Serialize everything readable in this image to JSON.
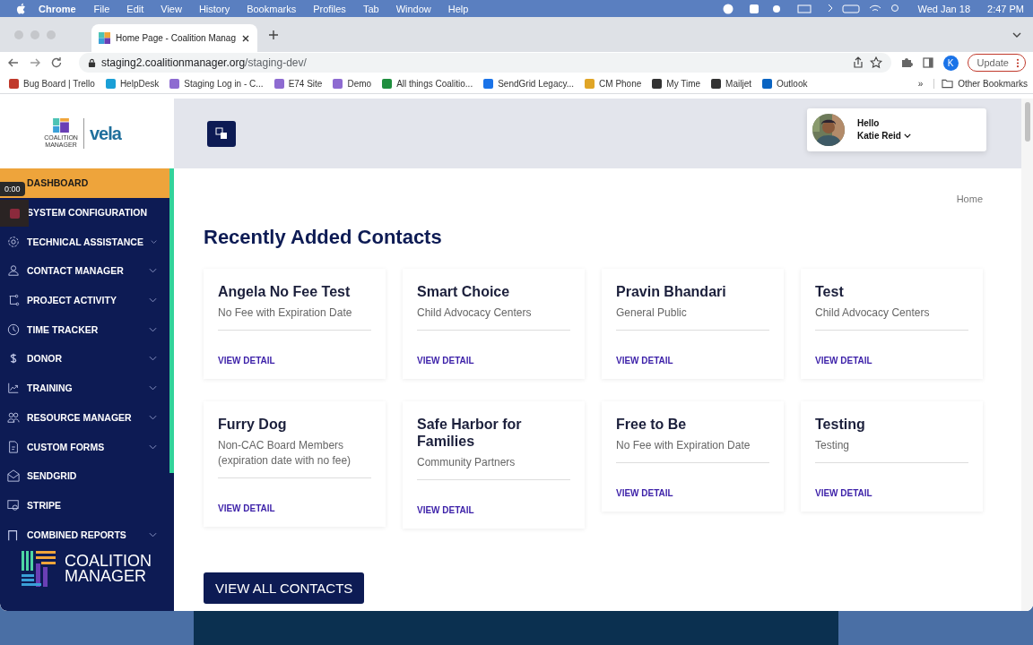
{
  "menubar": {
    "app": "Chrome",
    "menus": [
      "File",
      "Edit",
      "View",
      "History",
      "Bookmarks",
      "Profiles",
      "Tab",
      "Window",
      "Help"
    ],
    "date": "Wed Jan 18",
    "time": "2:47 PM"
  },
  "browser": {
    "tab_title": "Home Page - Coalition Manag",
    "url_host": "staging2.coalitionmanager.org",
    "url_path": "/staging-dev/",
    "profile": "K",
    "update_button": "Update",
    "bookmarks": [
      "Bug Board | Trello",
      "HelpDesk",
      "Staging Log in - C...",
      "E74 Site",
      "Demo",
      "All things Coalitio...",
      "SendGrid Legacy...",
      "CM Phone",
      "My Time",
      "Mailjet",
      "Outlook"
    ],
    "more": "»",
    "other_bookmarks": "Other Bookmarks"
  },
  "recording": {
    "time": "0:00"
  },
  "sidebar": {
    "logo": {
      "lines": [
        "COALITION",
        "MANAGER"
      ],
      "brand": "vela"
    },
    "items": [
      {
        "label": "DASHBOARD",
        "selected": true,
        "expandable": false
      },
      {
        "label": "SYSTEM CONFIGURATION",
        "selected": false,
        "expandable": false
      },
      {
        "label": "TECHNICAL ASSISTANCE",
        "selected": false,
        "expandable": true
      },
      {
        "label": "CONTACT MANAGER",
        "selected": false,
        "expandable": true
      },
      {
        "label": "PROJECT ACTIVITY",
        "selected": false,
        "expandable": true
      },
      {
        "label": "TIME TRACKER",
        "selected": false,
        "expandable": true
      },
      {
        "label": "DONOR",
        "selected": false,
        "expandable": true
      },
      {
        "label": "TRAINING",
        "selected": false,
        "expandable": true
      },
      {
        "label": "RESOURCE MANAGER",
        "selected": false,
        "expandable": true
      },
      {
        "label": "CUSTOM FORMS",
        "selected": false,
        "expandable": true
      },
      {
        "label": "SENDGRID",
        "selected": false,
        "expandable": false
      },
      {
        "label": "STRIPE",
        "selected": false,
        "expandable": false
      },
      {
        "label": "COMBINED REPORTS",
        "selected": false,
        "expandable": true
      }
    ],
    "footer_logo": [
      "COALITION",
      "MANAGER"
    ]
  },
  "header": {
    "greeting": "Hello",
    "user": "Katie Reid"
  },
  "breadcrumb": "Home",
  "title": "Recently Added Contacts",
  "contacts": [
    {
      "name": "Angela No Fee Test",
      "category": "No Fee with Expiration Date",
      "action": "VIEW DETAIL"
    },
    {
      "name": "Smart Choice",
      "category": "Child Advocacy Centers",
      "action": "VIEW DETAIL"
    },
    {
      "name": "Pravin Bhandari",
      "category": "General Public",
      "action": "VIEW DETAIL"
    },
    {
      "name": "Test",
      "category": "Child Advocacy Centers",
      "action": "VIEW DETAIL"
    },
    {
      "name": "Furry Dog",
      "category": "Non-CAC Board Members (expiration date with no fee)",
      "action": "VIEW DETAIL"
    },
    {
      "name": "Safe Harbor for Families",
      "category": "Community Partners",
      "action": "VIEW DETAIL"
    },
    {
      "name": "Free to Be",
      "category": "No Fee with Expiration Date",
      "action": "VIEW DETAIL"
    },
    {
      "name": "Testing",
      "category": "Testing",
      "action": "VIEW DETAIL"
    }
  ],
  "view_all_button": "VIEW ALL CONTACTS"
}
